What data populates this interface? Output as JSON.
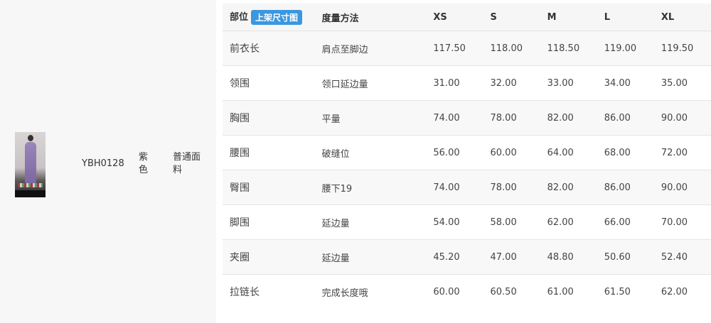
{
  "product": {
    "code": "YBH0128",
    "color": "紫色",
    "fabric": "普通面料"
  },
  "size_table": {
    "header": {
      "part": "部位",
      "badge": "上架尺寸图",
      "method": "度量方法",
      "sizes": [
        "XS",
        "S",
        "M",
        "L",
        "XL"
      ]
    },
    "rows": [
      {
        "part": "前衣长",
        "method": "肩点至脚边",
        "values": [
          "117.50",
          "118.00",
          "118.50",
          "119.00",
          "119.50"
        ]
      },
      {
        "part": "领围",
        "method": "领口延边量",
        "values": [
          "31.00",
          "32.00",
          "33.00",
          "34.00",
          "35.00"
        ]
      },
      {
        "part": "胸围",
        "method": "平量",
        "values": [
          "74.00",
          "78.00",
          "82.00",
          "86.00",
          "90.00"
        ]
      },
      {
        "part": "腰围",
        "method": "破缝位",
        "values": [
          "56.00",
          "60.00",
          "64.00",
          "68.00",
          "72.00"
        ]
      },
      {
        "part": "臀围",
        "method": "腰下19",
        "values": [
          "74.00",
          "78.00",
          "82.00",
          "86.00",
          "90.00"
        ]
      },
      {
        "part": "脚围",
        "method": "延边量",
        "values": [
          "54.00",
          "58.00",
          "62.00",
          "66.00",
          "70.00"
        ]
      },
      {
        "part": "夹圈",
        "method": "延边量",
        "values": [
          "45.20",
          "47.00",
          "48.80",
          "50.60",
          "52.40"
        ]
      },
      {
        "part": "拉链长",
        "method": "完成长度哦",
        "values": [
          "60.00",
          "60.50",
          "61.00",
          "61.50",
          "62.00"
        ]
      }
    ]
  },
  "colors": {
    "badge": "#3a97e0",
    "left_panel_bg": "#f7f7f7"
  }
}
